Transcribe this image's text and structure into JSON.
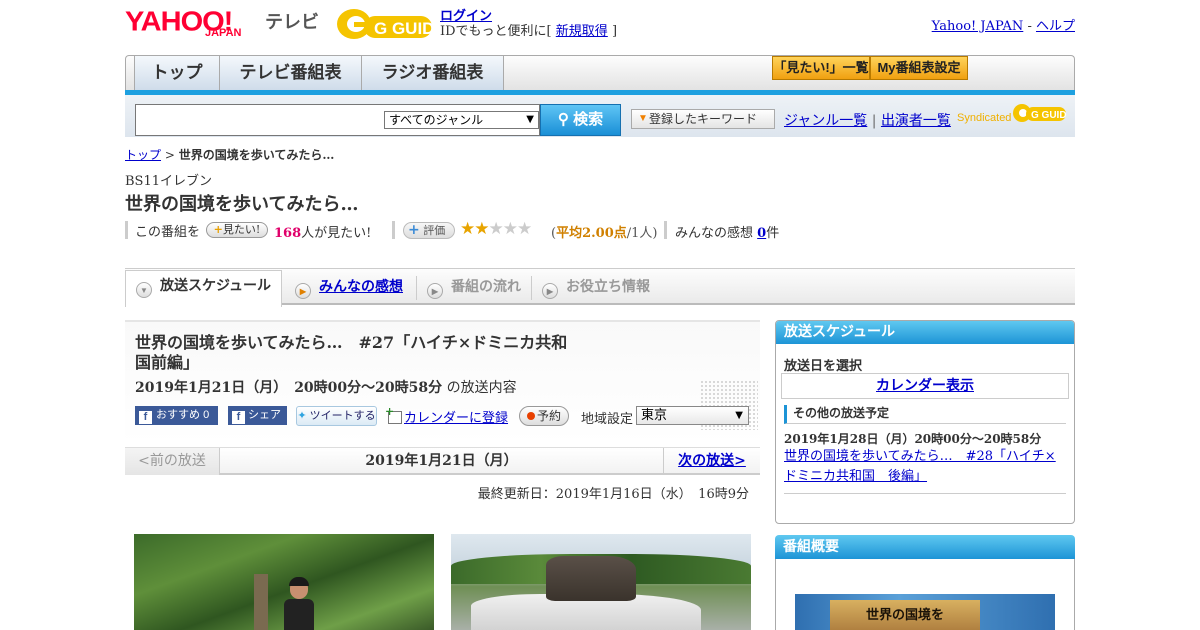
{
  "header": {
    "logo_main": "YAHOO!",
    "logo_sub": "JAPAN",
    "service": "テレビ",
    "gguide": "G GUIDE",
    "login": "ログイン",
    "id_prefix": "IDでもっと便利に[",
    "signup": "新規取得",
    "id_suffix": "]",
    "yahoo_japan": "Yahoo! JAPAN",
    "sep": "-",
    "help": "ヘルプ"
  },
  "nav": {
    "tabs": [
      "トップ",
      "テレビ番組表",
      "ラジオ番組表"
    ],
    "btn_mitai_list": "「見たい!」一覧",
    "btn_my_schedule": "My番組表設定"
  },
  "search": {
    "input_value": "",
    "genre_selected": "すべてのジャンル",
    "search_button": "検索",
    "keyword_button": "登録したキーワード",
    "genre_list": "ジャンル一覧",
    "divider": "|",
    "performer_list": "出演者一覧",
    "syndicated": "Syndicated"
  },
  "breadcrumb": {
    "top": "トップ",
    "sep": ">",
    "current": "世界の国境を歩いてみたら…"
  },
  "program": {
    "station": "BS11イレブン",
    "title": "世界の国境を歩いてみたら…",
    "mitai_prefix": "この番組を",
    "mitai_button": "見たい!",
    "mitai_count": "168",
    "mitai_suffix": "人が見たい!",
    "eval_button": "評価",
    "rating": 2,
    "rating_max": 5,
    "avg_open": "(",
    "avg_label": "平均2.00点",
    "avg_people": "/1人",
    "avg_close": ")",
    "kanso_label": "みんなの感想",
    "kanso_count": "0",
    "kanso_unit": "件"
  },
  "tabs": {
    "schedule": "放送スケジュール",
    "kanso": "みんなの感想",
    "flow": "番組の流れ",
    "info": "お役立ち情報"
  },
  "episode": {
    "title": "世界の国境を歩いてみたら…　#27「ハイチ×ドミニカ共和国前編」",
    "datetime": "2019年1月21日（月）　20時00分～20時58分",
    "datetime_suffix": "の放送内容",
    "fb_recommend": "おすすめ",
    "fb_count": "0",
    "fb_share": "シェア",
    "tweet": "ツイートする",
    "calendar_register": "カレンダーに登録",
    "reserve": "予約",
    "area_label": "地域設定",
    "area_selected": "東京"
  },
  "pager": {
    "prev": "<前の放送",
    "date": "2019年1月21日（月）",
    "next": "次の放送>"
  },
  "updated": "最終更新日：2019年1月16日（水）　16時9分",
  "sidebar": {
    "schedule_head": "放送スケジュール",
    "select_date": "放送日を選択",
    "calendar_view": "カレンダー表示",
    "other_head": "その他の放送予定",
    "other_date": "2019年1月28日（月）20時00分～20時58分",
    "other_link": "世界の国境を歩いてみたら…　#28「ハイチ×ドミニカ共和国　後編」",
    "summary_head": "番組概要",
    "thumb_text": "世界の国境を"
  },
  "icons": {
    "search": "search-icon",
    "facebook": "facebook-icon",
    "twitter": "twitter-bird-icon",
    "calendar": "calendar-add-icon",
    "reserve": "record-dot-icon"
  },
  "colors": {
    "yahoo_red": "#ff0033",
    "accent_blue": "#1d94d6",
    "link_blue": "#0000cc",
    "star": "#e8a400",
    "mitai_pink": "#e0006a"
  }
}
